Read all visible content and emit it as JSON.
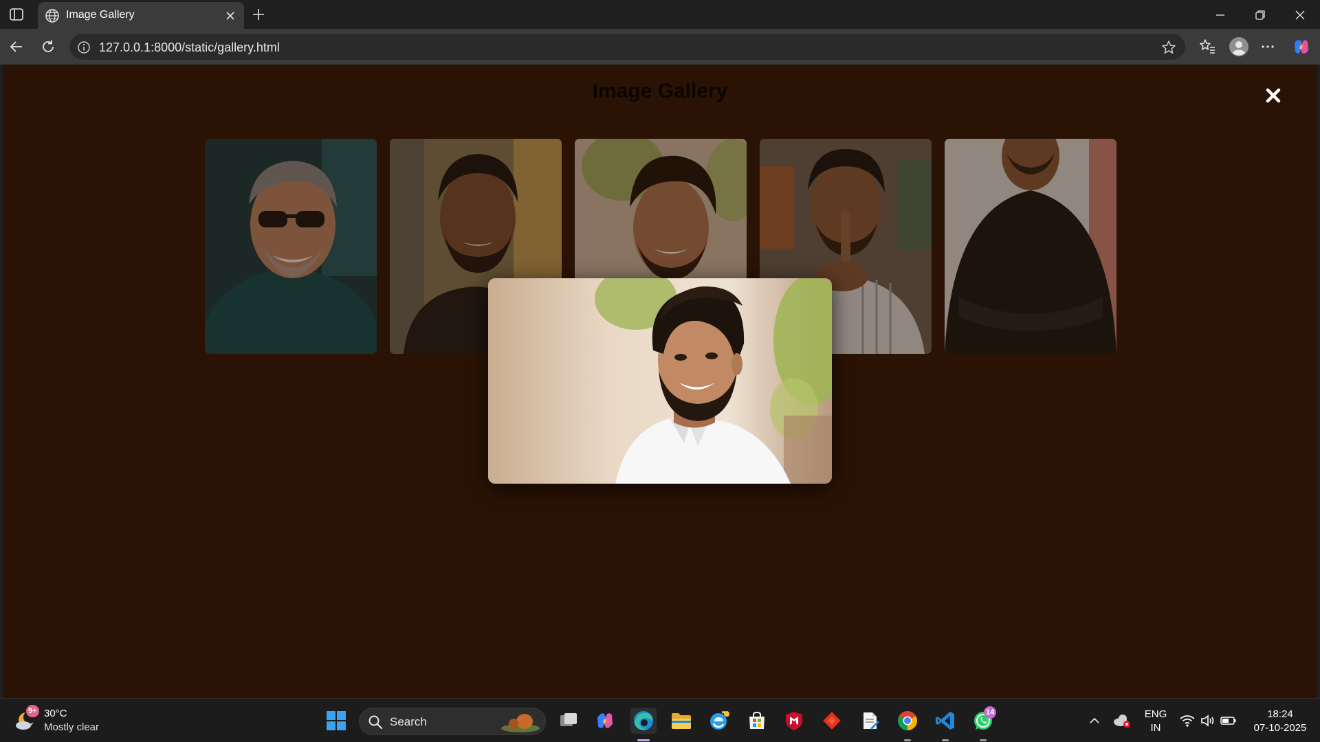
{
  "browser": {
    "tab_title": "Image Gallery",
    "url": "127.0.0.1:8000/static/gallery.html"
  },
  "page": {
    "title": "Image Gallery",
    "background": "#2a1305"
  },
  "gallery": {
    "thumbnail_count": 5,
    "selected_index": 3
  },
  "taskbar": {
    "weather_temp": "30°C",
    "weather_condition": "Mostly clear",
    "weather_badge": "9+",
    "search_label": "Search",
    "whatsapp_badge": "14",
    "language_line1": "ENG",
    "language_line2": "IN",
    "time": "18:24",
    "date": "07-10-2025"
  }
}
